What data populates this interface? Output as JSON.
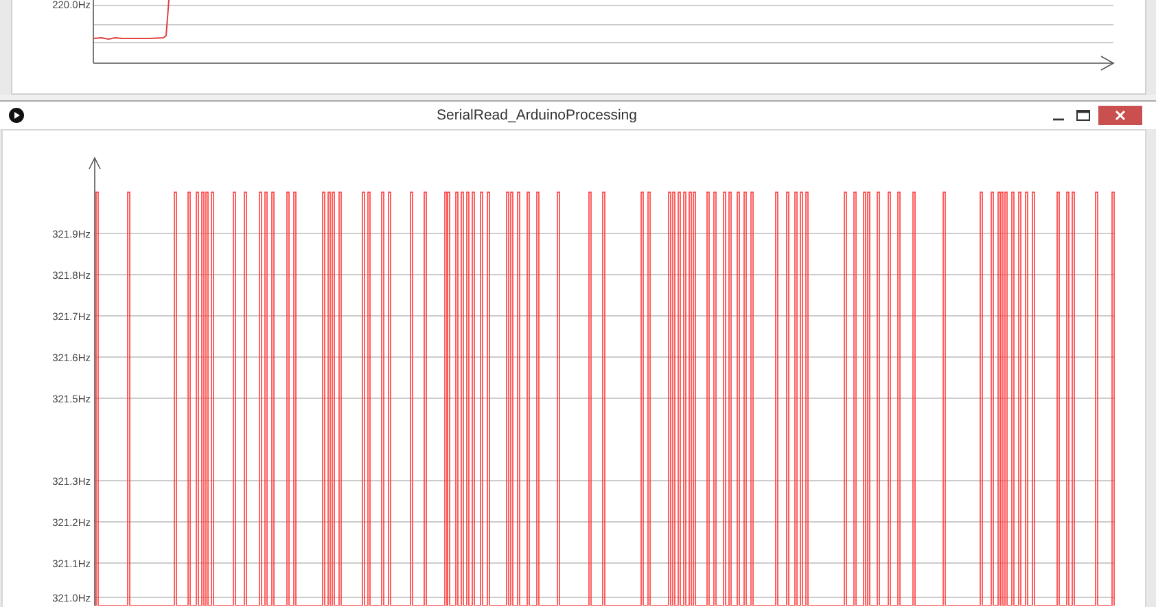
{
  "top_plot": {
    "y_labels": [
      "220.0Hz"
    ]
  },
  "window": {
    "title": "SerialRead_ArduinoProcessing"
  },
  "plot": {
    "y_labels": [
      "321.9Hz",
      "321.8Hz",
      "321.7Hz",
      "321.6Hz",
      "321.5Hz",
      "321.3Hz",
      "321.2Hz",
      "321.1Hz",
      "321.0Hz"
    ]
  }
}
